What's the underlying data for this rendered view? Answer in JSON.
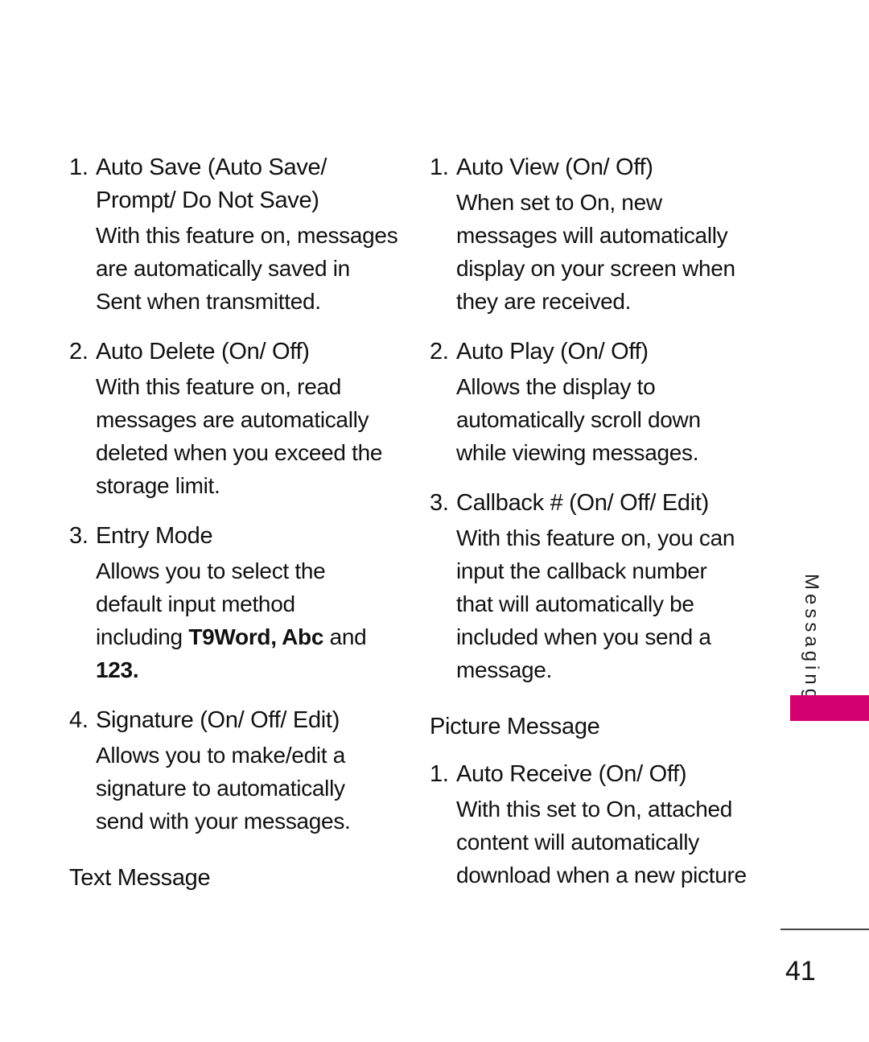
{
  "left_column": {
    "items": [
      {
        "num": "1.",
        "title_lines": [
          "Auto Save (Auto Save/",
          "Prompt/ Do Not Save)"
        ],
        "body_lines": [
          "With this feature on, messages",
          "are automatically saved in",
          "Sent when transmitted."
        ]
      },
      {
        "num": "2.",
        "title_lines": [
          "Auto Delete (On/ Off)"
        ],
        "body_lines": [
          "With this feature on, read",
          "messages are automatically",
          "deleted when you exceed the",
          "storage limit."
        ]
      },
      {
        "num": "3.",
        "title_lines": [
          "Entry Mode"
        ],
        "body_lines": [
          "Allows you to select the",
          "default input method"
        ],
        "body_rich": {
          "prefix": "including ",
          "bold1": "T9Word, Abc",
          "mid": " and",
          "bold2": "123."
        }
      },
      {
        "num": "4.",
        "title_lines": [
          "Signature (On/ Off/ Edit)"
        ],
        "body_lines": [
          "Allows you to make/edit a",
          "signature to automatically",
          "send with your messages."
        ]
      }
    ],
    "section_title": "Text Message"
  },
  "right_column": {
    "items": [
      {
        "num": "1.",
        "title": "Auto View (On/ Off)",
        "body_lines": [
          "When set to On, new",
          "messages will automatically",
          "display on your screen when",
          "they are received."
        ]
      },
      {
        "num": "2.",
        "title": "Auto Play (On/ Off)",
        "body_lines": [
          "Allows the display to",
          "automatically scroll down",
          "while viewing messages."
        ]
      },
      {
        "num": "3.",
        "title": "Callback # (On/ Off/ Edit)",
        "body_lines": [
          "With this feature on, you can",
          "input the callback number",
          "that will automatically be",
          "included when you send a",
          "message."
        ]
      }
    ],
    "section_title": "Picture Message",
    "picture_items": [
      {
        "num": "1.",
        "title": "Auto Receive (On/ Off)",
        "body_lines": [
          "With this set to On, attached",
          "content will automatically",
          "download when a new picture"
        ]
      }
    ]
  },
  "side_tab": {
    "label": "Messaging",
    "color": "#d4006f"
  },
  "page_number": "41"
}
